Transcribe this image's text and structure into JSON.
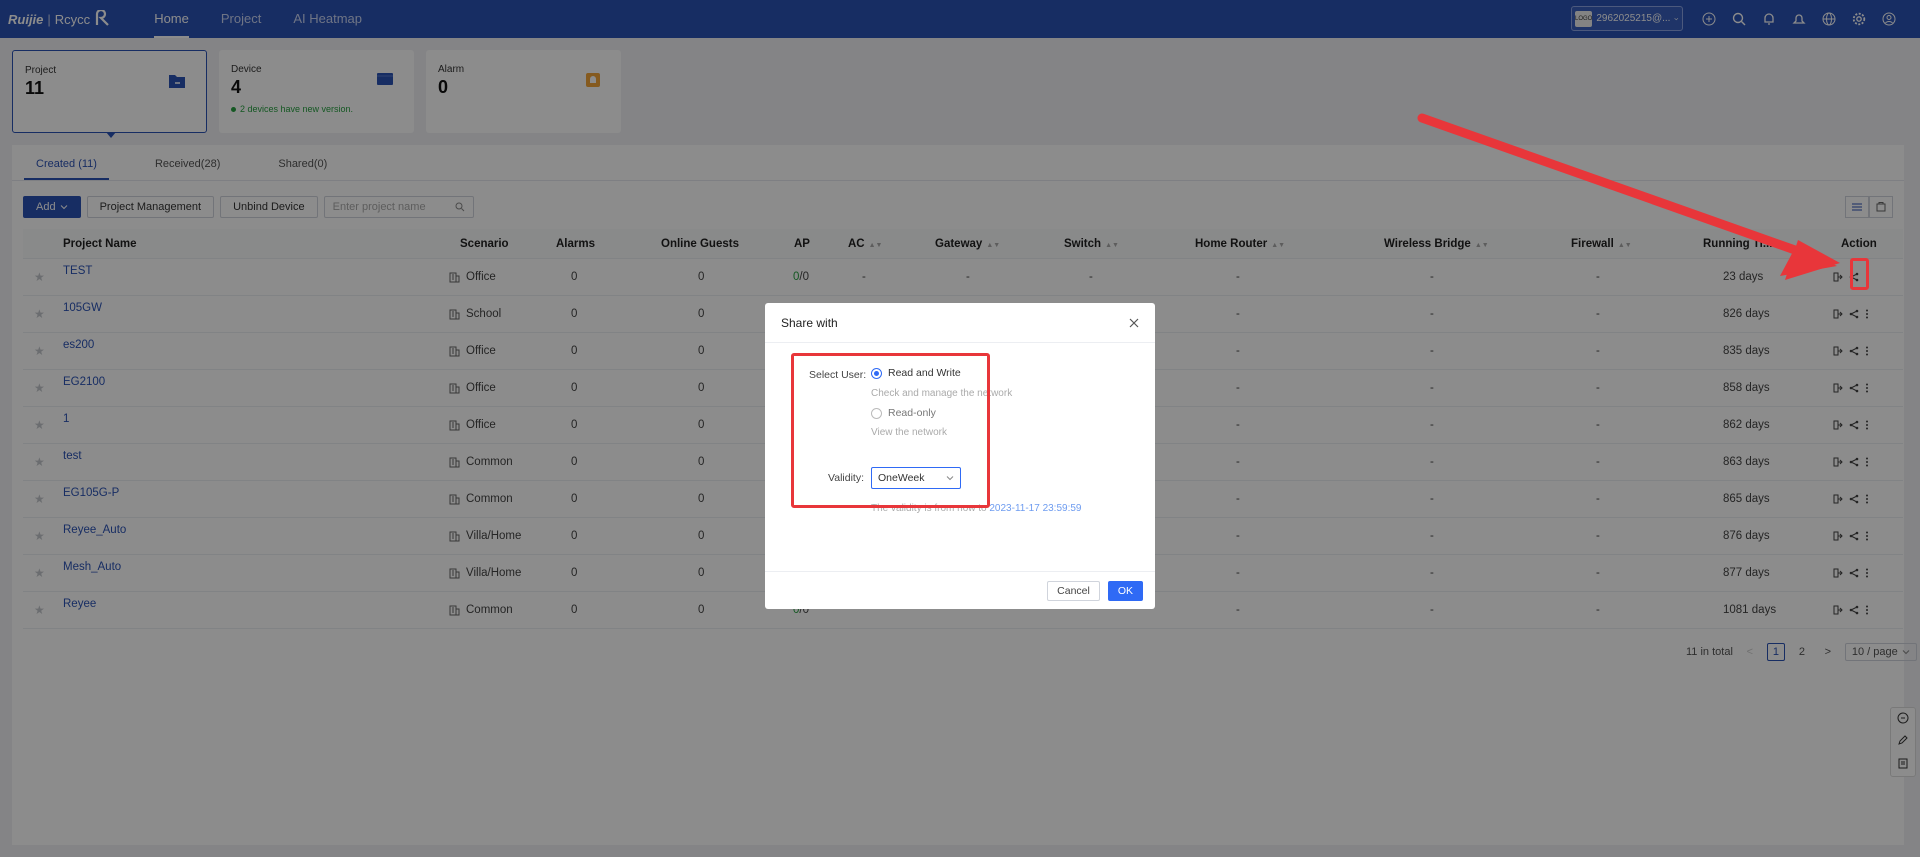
{
  "topbar": {
    "logo_brand": "Ruijie",
    "logo_sep": "|",
    "logo_product": "Rcycc",
    "nav": [
      "Home",
      "Project",
      "AI Heatmap"
    ],
    "account_logo": "LOGO",
    "account": "2962025215@...",
    "icons": [
      "add-icon",
      "search-icon",
      "bell-icon",
      "alert-icon",
      "globe-icon",
      "gear-icon",
      "user-icon"
    ]
  },
  "cards": {
    "project": {
      "label": "Project",
      "value": "11"
    },
    "device": {
      "label": "Device",
      "value": "4",
      "note": "2 devices have new version."
    },
    "alarm": {
      "label": "Alarm",
      "value": "0"
    }
  },
  "tabs": [
    "Created (11)",
    "Received(28)",
    "Shared(0)"
  ],
  "toolbar": {
    "add": "Add",
    "project_management": "Project Management",
    "unbind": "Unbind Device",
    "search_placeholder": "Enter project name"
  },
  "table": {
    "headers": [
      "Project Name",
      "Scenario",
      "Alarms",
      "Online Guests",
      "AP",
      "AC",
      "Gateway",
      "Switch",
      "Home Router",
      "Wireless Bridge",
      "Firewall",
      "Running Ti...",
      "Action"
    ],
    "rows": [
      {
        "name": "TEST",
        "scenario": "Office",
        "alarms": "0",
        "guests": "0",
        "ap_online": "0",
        "ap_total": "/0",
        "ac": "-",
        "gateway": "-",
        "switch": "-",
        "router": "-",
        "bridge": "-",
        "firewall": "-",
        "running": "23 days"
      },
      {
        "name": "105GW",
        "scenario": "School",
        "alarms": "0",
        "guests": "0",
        "router": "-",
        "bridge": "-",
        "firewall": "-",
        "running": "826 days"
      },
      {
        "name": "es200",
        "scenario": "Office",
        "alarms": "0",
        "guests": "0",
        "router": "-",
        "bridge": "-",
        "firewall": "-",
        "running": "835 days"
      },
      {
        "name": "EG2100",
        "scenario": "Office",
        "alarms": "0",
        "guests": "0",
        "router": "-",
        "bridge": "-",
        "firewall": "-",
        "running": "858 days"
      },
      {
        "name": "1",
        "scenario": "Office",
        "alarms": "0",
        "guests": "0",
        "router": "-",
        "bridge": "-",
        "firewall": "-",
        "running": "862 days"
      },
      {
        "name": "test",
        "scenario": "Common",
        "alarms": "0",
        "guests": "0",
        "router": "-",
        "bridge": "-",
        "firewall": "-",
        "running": "863 days"
      },
      {
        "name": "EG105G-P",
        "scenario": "Common",
        "alarms": "0",
        "guests": "0",
        "router": "-",
        "bridge": "-",
        "firewall": "-",
        "running": "865 days"
      },
      {
        "name": "Reyee_Auto",
        "scenario": "Villa/Home",
        "alarms": "0",
        "guests": "0",
        "router": "-",
        "bridge": "-",
        "firewall": "-",
        "running": "876 days"
      },
      {
        "name": "Mesh_Auto",
        "scenario": "Villa/Home",
        "alarms": "0",
        "guests": "0",
        "router": "-",
        "bridge": "-",
        "firewall": "-",
        "running": "877 days"
      },
      {
        "name": "Reyee",
        "scenario": "Common",
        "alarms": "0",
        "guests": "0",
        "ap_online": "0",
        "ap_total": "/0",
        "router": "-",
        "bridge": "-",
        "firewall": "-",
        "running": "1081 days"
      }
    ]
  },
  "pager": {
    "total": "11 in total",
    "prev": "<",
    "pages": [
      "1",
      "2"
    ],
    "next": ">",
    "size": "10 / page"
  },
  "modal": {
    "title": "Share with",
    "select_user_label": "Select User:",
    "rw_label": "Read and Write",
    "rw_desc": "Check and manage the network",
    "ro_label": "Read-only",
    "ro_desc": "View the network",
    "validity_label": "Validity:",
    "validity_value": "OneWeek",
    "validity_note_prefix": "The validity is from now to ",
    "validity_note_date": "2023-11-17 23:59:59",
    "cancel": "Cancel",
    "ok": "OK"
  },
  "colors": {
    "brand": "#2b52b5",
    "highlight": "#e8363a",
    "primary_button": "#2f6af5"
  }
}
